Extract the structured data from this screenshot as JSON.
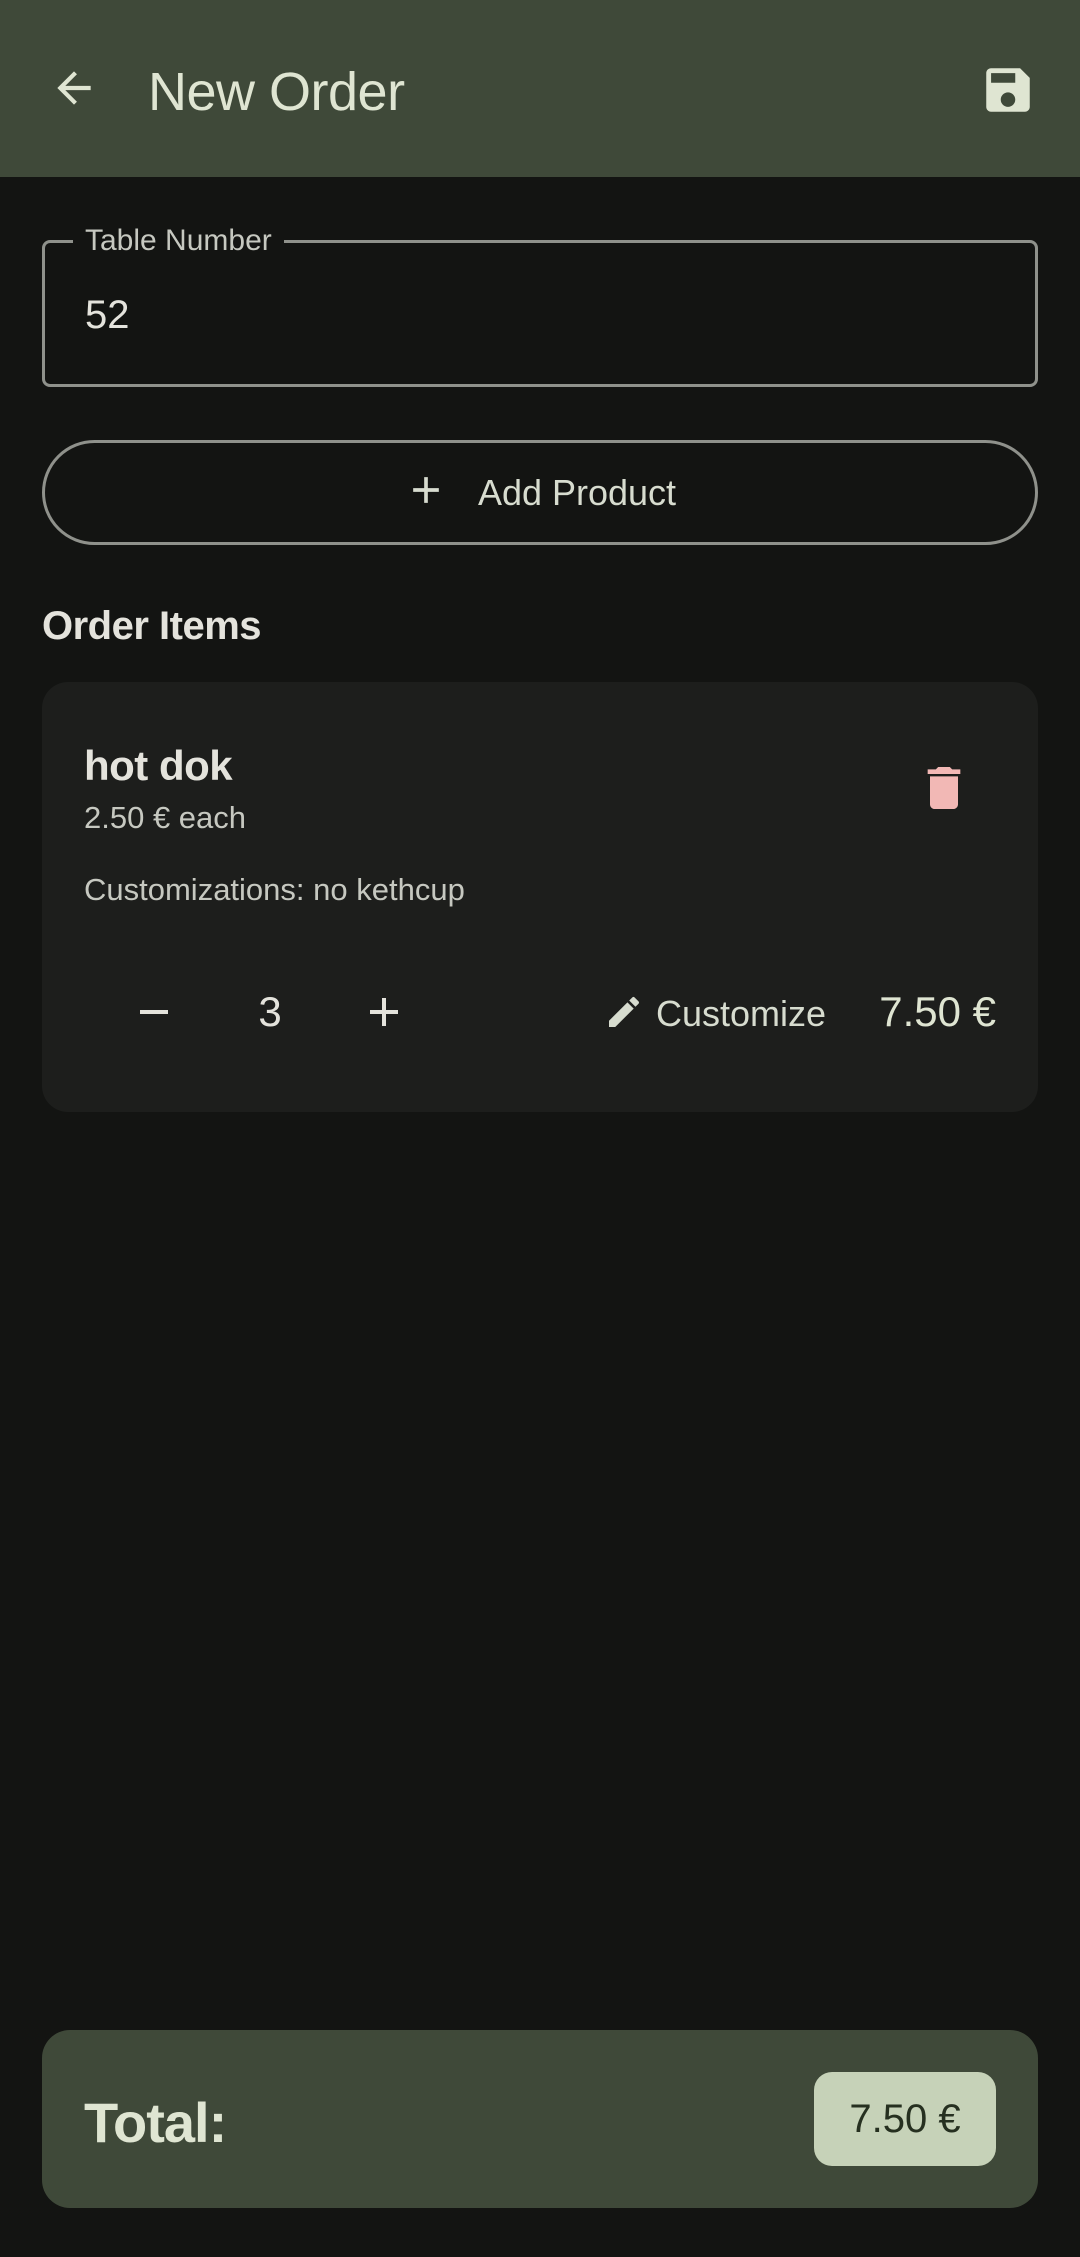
{
  "appbar": {
    "title": "New Order",
    "back_icon": "arrow-back-icon",
    "save_icon": "save-icon"
  },
  "table_field": {
    "label": "Table Number",
    "value": "52"
  },
  "add_product": {
    "label": "Add Product",
    "icon": "plus-icon"
  },
  "order_items": {
    "title": "Order Items",
    "items": [
      {
        "name": "hot dok",
        "unit_price": "2.50 € each",
        "customizations": "Customizations: no kethcup",
        "quantity": "3",
        "customize_label": "Customize",
        "line_total": "7.50 €"
      }
    ]
  },
  "total": {
    "label": "Total:",
    "value": "7.50 €"
  },
  "colors": {
    "appbar": "#3f4939",
    "background": "#131412",
    "card": "#1d1e1c",
    "delete_accent": "#f2b8b5",
    "total_chip": "#c6d2b8"
  }
}
